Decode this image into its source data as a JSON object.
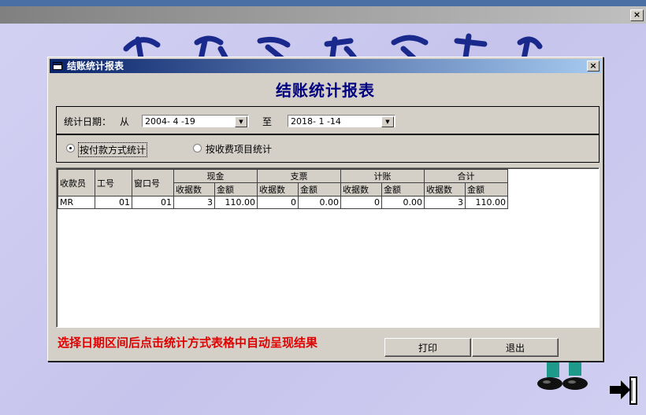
{
  "outer": {
    "close_glyph": "×"
  },
  "dialog": {
    "title": "结账统计报表",
    "close_glyph": "×",
    "report_title": "结账统计报表"
  },
  "date_filter": {
    "label": "统计日期：",
    "from_label": "从",
    "from_value": "2004- 4 -19",
    "to_label": "至",
    "to_value": "2018- 1 -14",
    "dropdown_glyph": "▼"
  },
  "stat_type": {
    "option1": "按付款方式统计",
    "option1_checked": true,
    "option2": "按收费项目统计",
    "option2_checked": false
  },
  "table": {
    "headers": {
      "cashier": "收款员",
      "staff_no": "工号",
      "window_no": "窗口号",
      "groups": [
        "现金",
        "支票",
        "计账",
        "合计"
      ],
      "sub_count": "收据数",
      "sub_amount": "金额"
    },
    "rows": [
      {
        "cashier": "MR",
        "staff_no": "01",
        "window_no": "01",
        "cash_count": "3",
        "cash_amount": "110.00",
        "check_count": "0",
        "check_amount": "0.00",
        "credit_count": "0",
        "credit_amount": "0.00",
        "total_count": "3",
        "total_amount": "110.00"
      }
    ]
  },
  "hint": "选择日期区间后点击统计方式表格中自动呈现结果",
  "buttons": {
    "print": "打印",
    "exit": "退出"
  },
  "icons": {
    "dialog_title": "window-icon",
    "exit": "exit-door-icon"
  }
}
